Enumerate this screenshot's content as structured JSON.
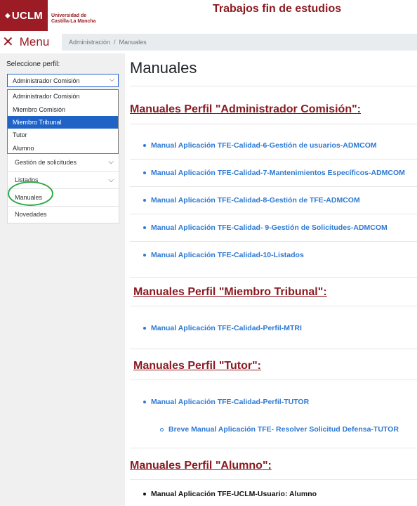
{
  "header": {
    "logo_text": "UCLM",
    "uni_line1": "Universidad de",
    "uni_line2": "Castilla-La Mancha",
    "title": "Trabajos fin de estudios"
  },
  "menu_toggle": {
    "icon": "close-icon",
    "label": "Menu"
  },
  "breadcrumb": {
    "items": [
      "Administración",
      "Manuales"
    ],
    "separator": "/"
  },
  "sidebar": {
    "profile_label": "Seleccione perfil:",
    "selected_profile": "Administrador Comisión",
    "options": [
      "Administrador Comisión",
      "Miembro Comisión",
      "Miembro Tribunal",
      "Tutor",
      "Alumno"
    ],
    "highlighted_option": "Miembro Tribunal",
    "menu_items": [
      {
        "label": "Gestión de solicitudes"
      },
      {
        "label": "Listados"
      },
      {
        "label": "Manuales"
      },
      {
        "label": "Novedades"
      }
    ]
  },
  "main": {
    "page_title": "Manuales",
    "sections": [
      {
        "title": "Manuales Perfil \"Administrador Comisión\":",
        "links": [
          "Manual Aplicación TFE-Calidad-6-Gestión de usuarios-ADMCOM",
          "Manual Aplicación TFE-Calidad-7-Mantenimientos Específicos-ADMCOM",
          "Manual Aplicación TFE-Calidad-8-Gestión de TFE-ADMCOM",
          "Manual Aplicación TFE-Calidad- 9-Gestión de Solicitudes-ADMCOM",
          "Manual Aplicación TFE-Calidad-10-Listados"
        ]
      },
      {
        "title": "Manuales Perfil \"Miembro Tribunal\":",
        "links": [
          "Manual Aplicación TFE-Calidad-Perfil-MTRI"
        ]
      },
      {
        "title": "Manuales Perfil \"Tutor\":",
        "links": [
          "Manual Aplicación TFE-Calidad-Perfil-TUTOR"
        ],
        "sublinks": [
          "Breve Manual Aplicación TFE- Resolver Solicitud Defensa-TUTOR"
        ]
      },
      {
        "title": "Manuales Perfil \"Alumno\":",
        "links": [
          "Manual Aplicación TFE-UCLM-Usuario: Alumno"
        ]
      }
    ]
  },
  "colors": {
    "brand": "#9b1c24",
    "link": "#2d79d3",
    "highlight": "#1f63c7",
    "annotation": "#2daa4a"
  }
}
